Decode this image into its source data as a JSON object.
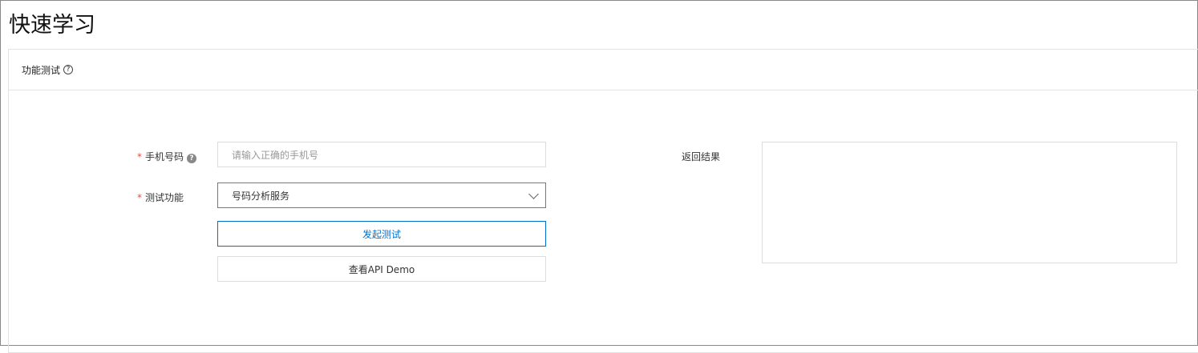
{
  "page": {
    "title": "快速学习"
  },
  "card": {
    "title": "功能测试",
    "help_icon": "question-circle-icon",
    "form": {
      "phone": {
        "label": "手机号码",
        "required_mark": "*",
        "placeholder": "请输入正确的手机号",
        "value": ""
      },
      "feature": {
        "label": "测试功能",
        "required_mark": "*",
        "selected": "号码分析服务"
      },
      "submit_label": "发起测试",
      "demo_label": "查看API Demo"
    },
    "result": {
      "label": "返回结果",
      "value": ""
    }
  },
  "colors": {
    "primary": "#0070cc",
    "required": "#e54d42"
  }
}
